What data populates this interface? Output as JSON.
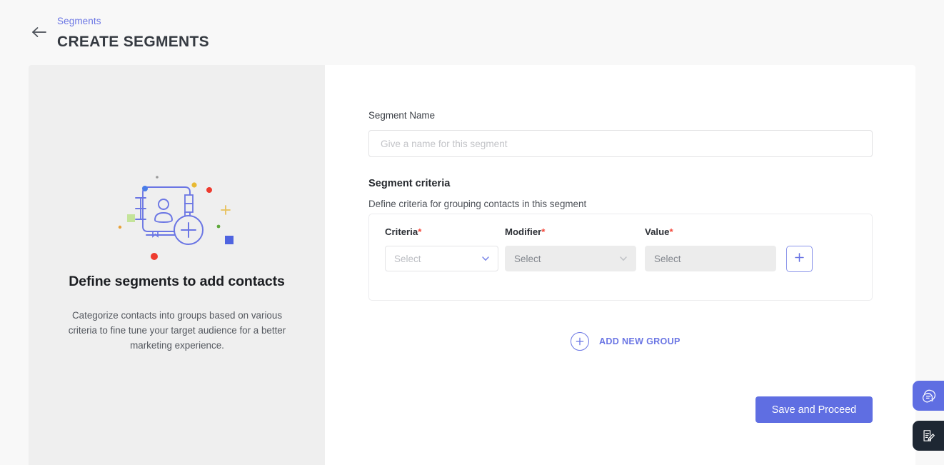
{
  "header": {
    "back_icon": "arrow-left-icon",
    "breadcrumb": "Segments",
    "title": "CREATE SEGMENTS"
  },
  "left_panel": {
    "illustration_icon": "contact-book-add-illustration",
    "heading": "Define segments to add contacts",
    "description": "Categorize contacts into groups based on various criteria to fine tune your target audience for a better marketing experience.",
    "background_color": "#efefef",
    "illustration_colors": {
      "line": "#6b76e4",
      "blue_dot": "#4a7de8",
      "red_dot": "#ee3b2f",
      "yellow_dot": "#e8b932",
      "green_square": "#c4e49a",
      "blue_square": "#4f64e0",
      "green_dot": "#5fa83c",
      "orange_dot": "#e8a23a",
      "gray_dot": "#9a9a9a",
      "plus_yellow": "#e8c05a"
    }
  },
  "form": {
    "segment_name_label": "Segment Name",
    "segment_name_value": "",
    "segment_name_placeholder": "Give a name for this segment",
    "section_title": "Segment criteria",
    "section_subtitle": "Define criteria for grouping contacts in this segment",
    "criteria_group": {
      "columns": [
        {
          "label": "Criteria",
          "required": "*",
          "value": "Select",
          "state": "enabled",
          "has_chevron": true
        },
        {
          "label": "Modifier",
          "required": "*",
          "value": "Select",
          "state": "disabled",
          "has_chevron": true
        },
        {
          "label": "Value",
          "required": "*",
          "value": "Select",
          "state": "disabled",
          "has_chevron": false
        }
      ],
      "add_criteria_icon": "plus-icon"
    },
    "add_group": {
      "icon": "circle-plus-icon",
      "label": "ADD NEW GROUP"
    },
    "save_label": "Save and Proceed"
  },
  "floating_widgets": [
    {
      "name": "chat-bubbles-icon",
      "color": "#5f6ee2"
    },
    {
      "name": "note-edit-icon",
      "color": "#1e2733"
    }
  ],
  "colors": {
    "accent": "#6b76e4",
    "primary_button": "#5f6ee2",
    "required_star": "#f4493c",
    "page_background": "#f8f8f8"
  }
}
